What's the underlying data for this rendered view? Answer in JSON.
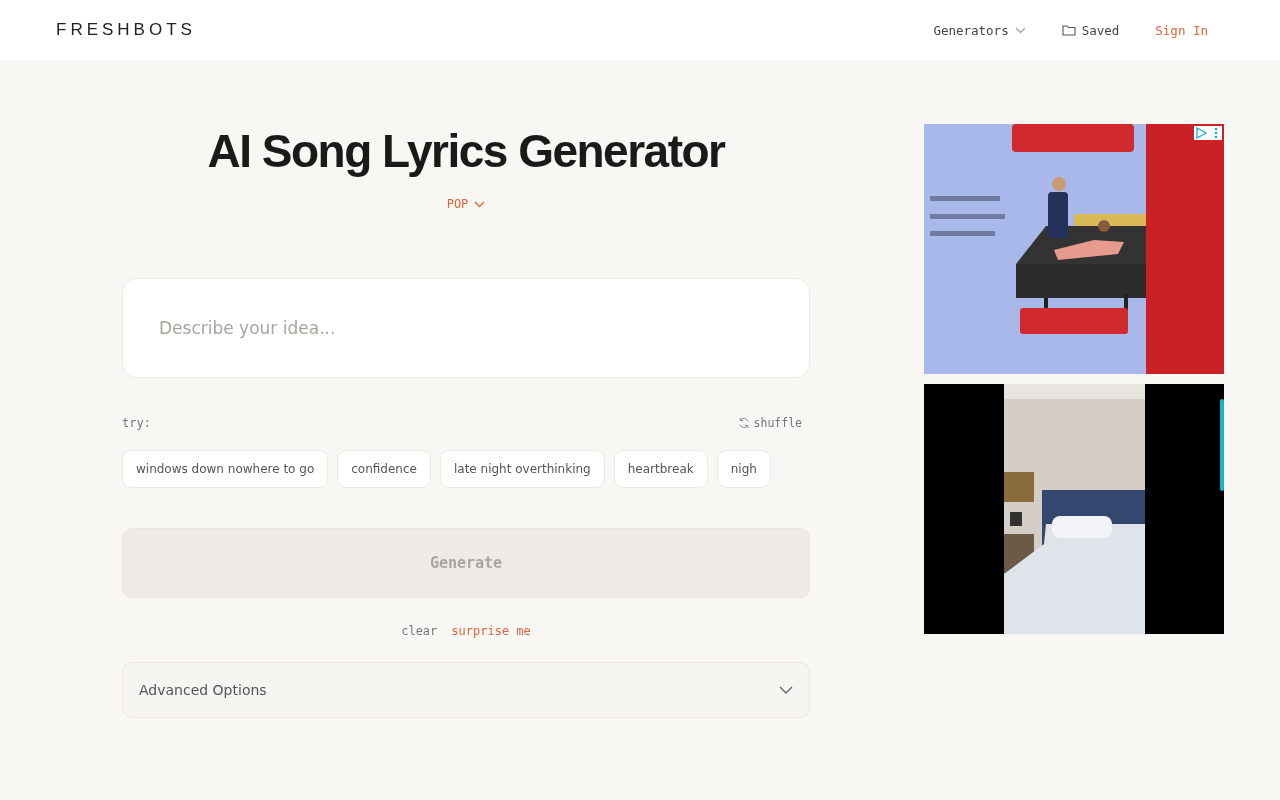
{
  "header": {
    "logo": "FRESHBOTS",
    "nav": [
      {
        "kind": "dropdown",
        "label": "Generators"
      },
      {
        "kind": "folder",
        "label": "Saved"
      },
      {
        "kind": "accent",
        "label": "Sign In"
      }
    ]
  },
  "title": "AI Song Lyrics Generator",
  "genre": {
    "label": "POP"
  },
  "idea": {
    "placeholder": "Describe your idea..."
  },
  "suggestions": {
    "label": "try:",
    "shuffle": "shuffle",
    "chips": [
      "windows down nowhere to go",
      "confidence",
      "late night overthinking",
      "heartbreak",
      "nigh"
    ]
  },
  "generate": {
    "label": "Generate",
    "disabled": true
  },
  "links": [
    {
      "label": "clear",
      "accent": false
    },
    {
      "label": "surprise me",
      "accent": true
    }
  ],
  "advanced": {
    "label": "Advanced Options",
    "expanded": false
  }
}
